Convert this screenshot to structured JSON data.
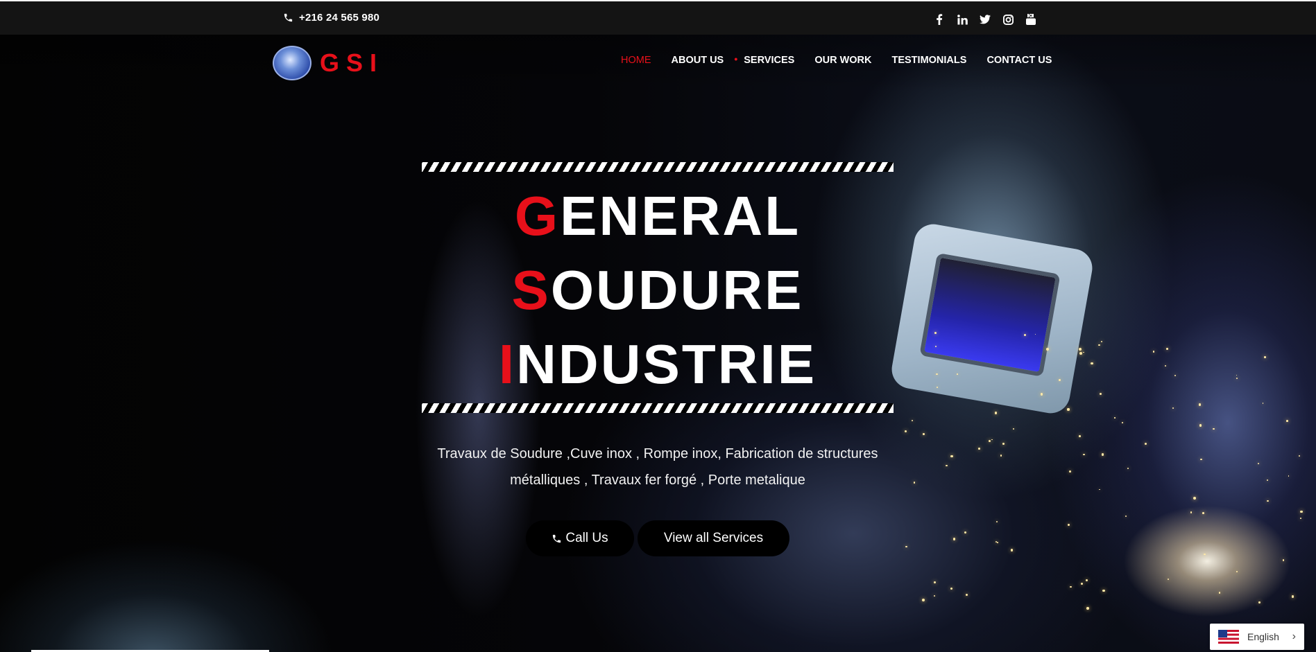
{
  "topbar": {
    "phone": "+216 24 565 980",
    "phone_icon": "phone-icon",
    "socials": [
      "facebook-icon",
      "linkedin-icon",
      "twitter-icon",
      "instagram-icon",
      "youtube-icon"
    ]
  },
  "logo": {
    "text": "GSI"
  },
  "nav": {
    "items": [
      {
        "label": "HOME"
      },
      {
        "label": "ABOUT US"
      },
      {
        "label": "SERVICES"
      },
      {
        "label": "OUR WORK"
      },
      {
        "label": "TESTIMONIALS"
      },
      {
        "label": "CONTACT US"
      }
    ],
    "indicator": "•"
  },
  "hero": {
    "lines": [
      {
        "first": "G",
        "rest": "ENERAL"
      },
      {
        "first": "S",
        "rest": "OUDURE"
      },
      {
        "first": "I",
        "rest": "NDUSTRIE"
      }
    ],
    "tagline_1": "Travaux de Soudure ,Cuve inox , Rompe inox, Fabrication de structures",
    "tagline_2": "métalliques , Travaux fer forgé , Porte metalique",
    "call_label": "Call Us",
    "services_label": "View all Services"
  },
  "language": {
    "label": "English"
  },
  "colors": {
    "accent": "#e8101a",
    "topbar": "#141414",
    "background": "#000000"
  }
}
